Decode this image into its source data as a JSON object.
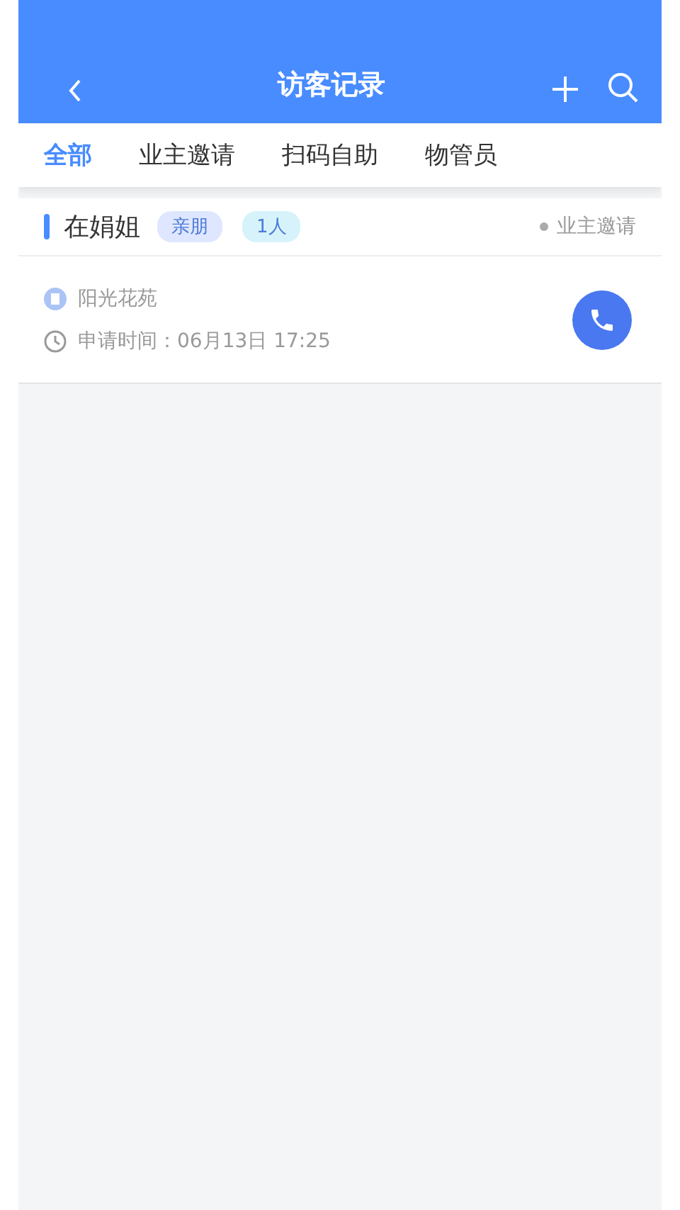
{
  "header": {
    "title": "访客记录"
  },
  "tabs": [
    {
      "label": "全部",
      "selected": true
    },
    {
      "label": "业主邀请",
      "selected": false
    },
    {
      "label": "扫码自助",
      "selected": false
    },
    {
      "label": "物管员",
      "selected": false
    }
  ],
  "visits": [
    {
      "name": "在娟姐",
      "tags": [
        {
          "text": "亲朋",
          "color": "#dfe6ff"
        },
        {
          "text": "1人",
          "color": "#d6f3fb"
        }
      ],
      "source": "业主邀请",
      "community": "阳光花苑",
      "time": "申请时间：06月13日 17:25"
    }
  ]
}
